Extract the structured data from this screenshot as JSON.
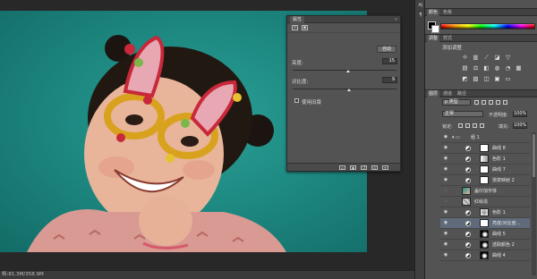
{
  "status": {
    "doc_info": "档:81.3M/358.9M"
  },
  "properties_panel": {
    "tab_label": "属性",
    "auto_label": "自动",
    "brightness_label": "亮度:",
    "brightness_value": "15",
    "contrast_label": "对比度:",
    "contrast_value": "9",
    "legacy_label": "使用旧版"
  },
  "dock": {
    "icon1": "A|",
    "icon2": "¶"
  },
  "top_tabs": {
    "tab1": "颜色",
    "tab2": "色板"
  },
  "adjustments": {
    "tab1": "调整",
    "tab2": "样式",
    "title": "添加调整"
  },
  "layers_panel": {
    "tab1": "图层",
    "tab2": "通道",
    "tab3": "路径",
    "filter_kind": "p 类型",
    "blend_mode": "正常",
    "opacity_label": "不透明度:",
    "opacity_value": "100%",
    "lock_label": "锁定:",
    "fill_label": "填充:",
    "fill_value": "100%",
    "layers": [
      {
        "name": "组 1",
        "type": "group",
        "selected": false
      },
      {
        "name": "曲线 8",
        "type": "adjustment",
        "selected": false
      },
      {
        "name": "色阶 1",
        "type": "adjustment",
        "selected": false
      },
      {
        "name": "曲线 7",
        "type": "adjustment",
        "selected": false
      },
      {
        "name": "渐变映射 2",
        "type": "adjustment",
        "selected": false
      },
      {
        "name": "盖印加字体",
        "type": "pixel",
        "selected": false
      },
      {
        "name": "红绘造",
        "type": "pattern",
        "selected": false
      },
      {
        "name": "色阶 1",
        "type": "adjustment",
        "selected": false
      },
      {
        "name": "亮度/对比度...",
        "type": "adjustment",
        "selected": true
      },
      {
        "name": "曲线 5",
        "type": "adjustment-dark",
        "selected": false
      },
      {
        "name": "选取颜色 2",
        "type": "adjustment-dark",
        "selected": false
      },
      {
        "name": "曲线 4",
        "type": "adjustment-dark",
        "selected": false
      }
    ]
  }
}
